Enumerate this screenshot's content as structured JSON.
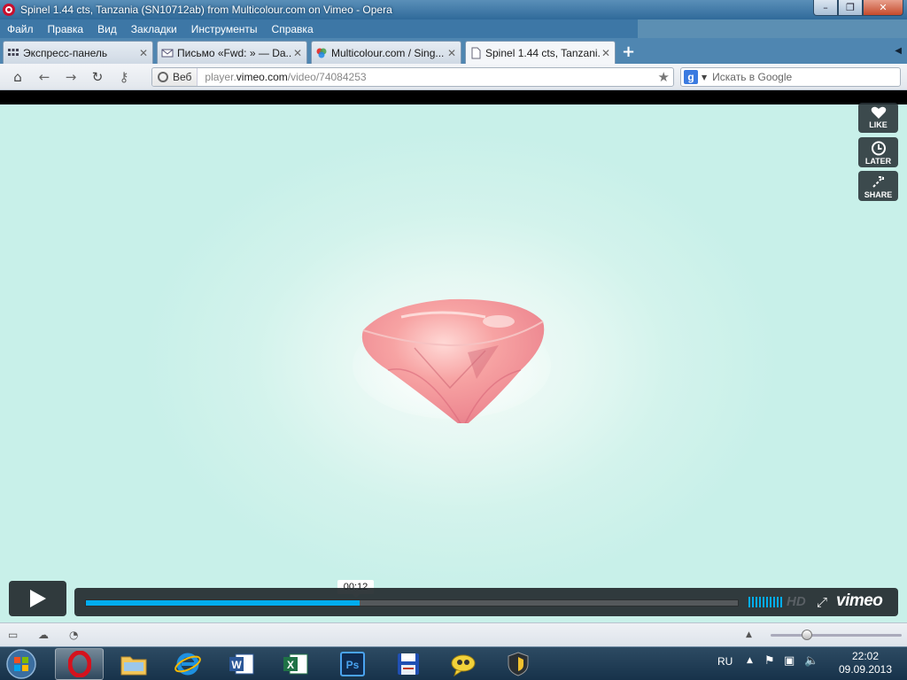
{
  "window": {
    "title": "Spinel 1.44 cts, Tanzania (SN10712ab) from Multicolour.com on Vimeo - Opera",
    "controls": [
      "–",
      "❐",
      "✕"
    ]
  },
  "menu": [
    "Файл",
    "Правка",
    "Вид",
    "Закладки",
    "Инструменты",
    "Справка"
  ],
  "tabs": [
    {
      "label": "Экспресс-панель",
      "icon": "grid-icon"
    },
    {
      "label": "Письмо «Fwd: » — Da...",
      "icon": "mail-icon"
    },
    {
      "label": "Multicolour.com / Sing...",
      "icon": "multicolour-icon"
    },
    {
      "label": "Spinel 1.44 cts, Tanzani...",
      "icon": "page-icon",
      "active": true
    }
  ],
  "address": {
    "badge": "Веб",
    "url_prefix": "player.",
    "url_domain": "vimeo.com",
    "url_path": "/video/74084253"
  },
  "search": {
    "engine": "g",
    "placeholder": "Искать в Google"
  },
  "video": {
    "side_buttons": [
      "LIKE",
      "LATER",
      "SHARE"
    ],
    "current_time": "00:12",
    "progress_fraction": 0.42,
    "hd_label": "HD",
    "brand": "vimeo",
    "accent": "#00adef"
  },
  "tray": {
    "language": "RU",
    "time": "22:02",
    "date": "09.09.2013"
  }
}
